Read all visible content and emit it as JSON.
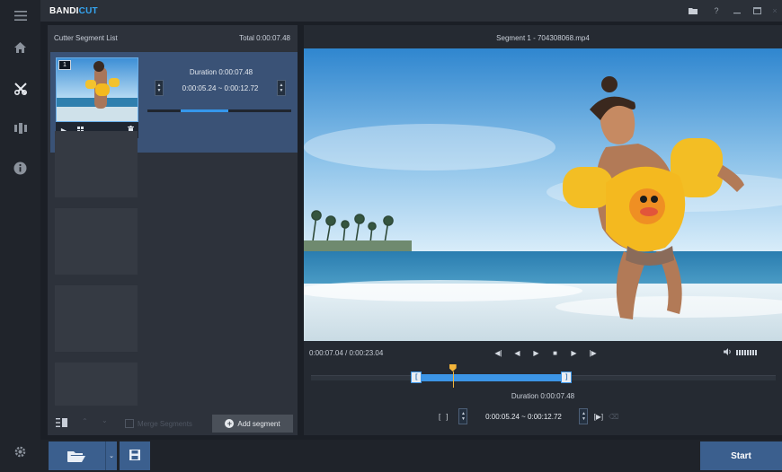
{
  "app": {
    "brand_part1": "BANDI",
    "brand_part2": "CUT"
  },
  "colors": {
    "accent": "#3c95e6",
    "brand_blue": "#35a6f2",
    "marker": "#f3b43a",
    "button": "#3b5f8e"
  },
  "rail": {
    "icons": [
      "menu-icon",
      "home-icon",
      "cutter-icon",
      "joiner-icon",
      "info-icon",
      "settings-icon"
    ]
  },
  "left_panel": {
    "header_title": "Cutter Segment List",
    "total": "Total 0:00:07.48",
    "segment": {
      "number": "1",
      "duration": "Duration 0:00:07.48",
      "range": "0:00:05.24 ~ 0:00:12.72",
      "progress_start": 0.23,
      "progress_end": 0.56
    },
    "merge_label": "Merge Segments",
    "add_segment": "Add segment"
  },
  "right_panel": {
    "title": "Segment 1 - 704308068.mp4",
    "time": "0:00:07.04 / 0:00:23.04",
    "timeline": {
      "start_fraction": 0.227,
      "end_fraction": 0.55,
      "position_fraction": 0.305,
      "start_marker": "[",
      "end_marker": "]"
    },
    "duration": "Duration 0:00:07.48",
    "range": "0:00:05.24 ~ 0:00:12.72"
  },
  "bottom": {
    "start_label": "Start"
  }
}
